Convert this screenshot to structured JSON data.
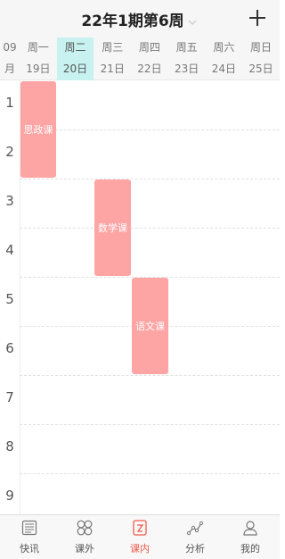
{
  "header": {
    "title": "22年1期第6周"
  },
  "week": {
    "month_top": "09",
    "month_bottom": "月",
    "days": [
      {
        "weekday": "周一",
        "date": "19日"
      },
      {
        "weekday": "周二",
        "date": "20日",
        "today": true
      },
      {
        "weekday": "周三",
        "date": "21日"
      },
      {
        "weekday": "周四",
        "date": "22日"
      },
      {
        "weekday": "周五",
        "date": "23日"
      },
      {
        "weekday": "周六",
        "date": "24日"
      },
      {
        "weekday": "周日",
        "date": "25日"
      }
    ]
  },
  "slots": [
    "1",
    "2",
    "3",
    "4",
    "5",
    "6",
    "7",
    "8",
    "9"
  ],
  "courses": [
    {
      "name": "思政课",
      "day": 1,
      "start": 1,
      "end": 2
    },
    {
      "name": "数学课",
      "day": 3,
      "start": 3,
      "end": 4
    },
    {
      "name": "语文课",
      "day": 4,
      "start": 5,
      "end": 6
    }
  ],
  "colors": {
    "course": "#fda4a4",
    "today": "#c8f2f0",
    "active_tab": "#f15a4a"
  },
  "tabs": [
    {
      "label": "快讯",
      "icon": "news-icon"
    },
    {
      "label": "课外",
      "icon": "pinwheel-icon"
    },
    {
      "label": "课内",
      "icon": "schedule-icon",
      "active": true
    },
    {
      "label": "分析",
      "icon": "analysis-icon"
    },
    {
      "label": "我的",
      "icon": "profile-icon"
    }
  ]
}
